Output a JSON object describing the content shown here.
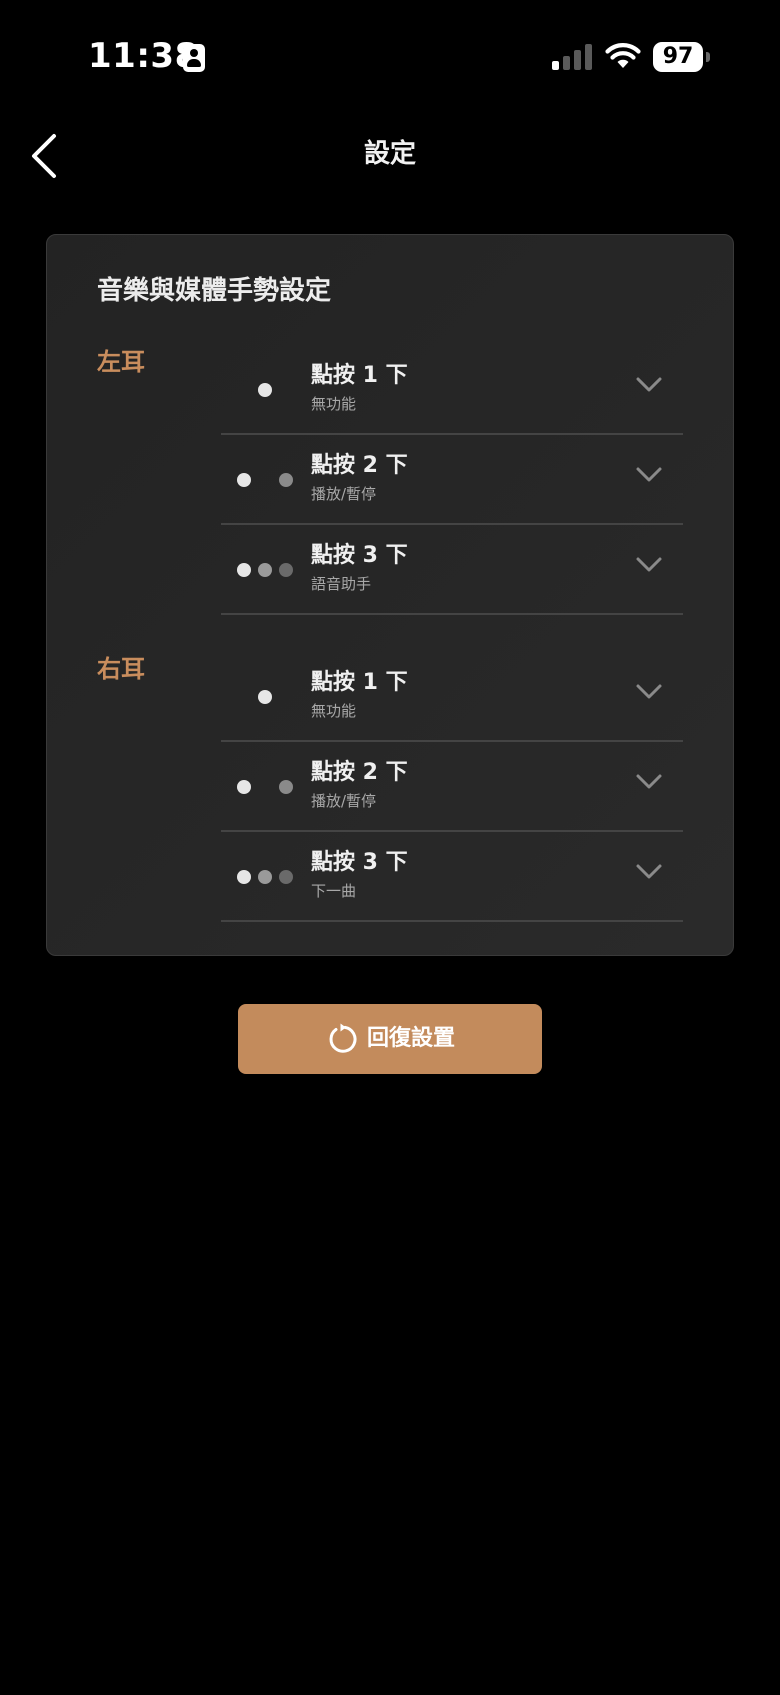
{
  "status_bar": {
    "time": "11:38",
    "battery_level": "97"
  },
  "nav": {
    "title": "設定"
  },
  "card": {
    "title": "音樂與媒體手勢設定",
    "sections": [
      {
        "label": "左耳",
        "rows": [
          {
            "title": "點按 1 下",
            "value": "無功能"
          },
          {
            "title": "點按 2 下",
            "value": "播放/暫停"
          },
          {
            "title": "點按 3 下",
            "value": "語音助手"
          }
        ]
      },
      {
        "label": "右耳",
        "rows": [
          {
            "title": "點按 1 下",
            "value": "無功能"
          },
          {
            "title": "點按 2 下",
            "value": "播放/暫停"
          },
          {
            "title": "點按 3 下",
            "value": "下一曲"
          }
        ]
      }
    ]
  },
  "reset_button": {
    "label": "回復設置"
  },
  "colors": {
    "accent": "#c38b5c",
    "ear_label": "#c98d5d",
    "card_bg": "#262626",
    "divider": "#444444",
    "dot_bright": "#e6e6e6",
    "dot_mid": "#9a9a9a",
    "dot_dim": "#6a6a6a"
  }
}
